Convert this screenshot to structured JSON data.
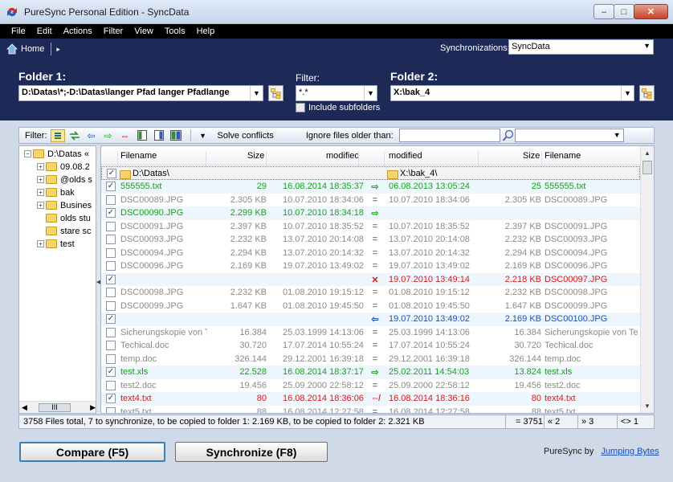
{
  "window": {
    "title": "PureSync Personal Edition  -  SyncData",
    "minimize": "–",
    "maximize": "□",
    "close": "✕"
  },
  "menu": [
    "File",
    "Edit",
    "Actions",
    "Filter",
    "View",
    "Tools",
    "Help"
  ],
  "nav": {
    "home": "Home",
    "sync_label": "Synchronizations:",
    "sync_value": "SyncData"
  },
  "folder1": {
    "label": "Folder 1:",
    "path": "D:\\Datas\\*;-D:\\Datas\\langer Pfad langer Pfadlange"
  },
  "filter": {
    "label": "Filter:",
    "value": "*.*",
    "include_subfolders": "Include subfolders"
  },
  "folder2": {
    "label": "Folder 2:",
    "path": "X:\\bak_4"
  },
  "toolbar": {
    "filter_label": "Filter:",
    "solve": "Solve conflicts",
    "ignore": "Ignore files older than:"
  },
  "tree": {
    "root": "D:\\Datas «",
    "items": [
      "09.08.2",
      "@olds s",
      "bak",
      "Busines",
      "olds stu",
      "stare sc",
      "test"
    ],
    "scroll": "‹  III  ›"
  },
  "grid": {
    "headers": {
      "filename_l": "Filename",
      "size_l": "Size",
      "mod_l": "modified",
      "mod_r": "modified",
      "size_r": "Size",
      "filename_r": "Filename"
    },
    "folder_row": {
      "left": "D:\\Datas\\",
      "right": "X:\\bak_4\\"
    },
    "rows": [
      {
        "name": "555555.txt",
        "size": "29",
        "mod": "16.08.2014 18:35:37",
        "act": "⇨",
        "mod2": "06.08.2013 13:05:24",
        "size2": "25",
        "name2": "555555.txt",
        "checked": true,
        "color": "#17a11a",
        "acolor": "#2aa32a"
      },
      {
        "name": "DSC00089.JPG",
        "size": "2.305 KB",
        "mod": "10.07.2010 18:34:06",
        "act": "=",
        "mod2": "10.07.2010 18:34:06",
        "size2": "2.305 KB",
        "name2": "DSC00089.JPG",
        "checked": false,
        "color": "#8a8a8a",
        "acolor": "#8a8a8a"
      },
      {
        "name": "DSC00090.JPG",
        "size": "2.299 KB",
        "mod": "10.07.2010 18:34:18",
        "act": "⇨",
        "mod2": "",
        "size2": "",
        "name2": "",
        "checked": true,
        "color": "#17a11a",
        "acolor": "#2aa32a"
      },
      {
        "name": "DSC00091.JPG",
        "size": "2.397 KB",
        "mod": "10.07.2010 18:35:52",
        "act": "=",
        "mod2": "10.07.2010 18:35:52",
        "size2": "2.397 KB",
        "name2": "DSC00091.JPG",
        "checked": false,
        "color": "#8a8a8a",
        "acolor": "#8a8a8a"
      },
      {
        "name": "DSC00093.JPG",
        "size": "2.232 KB",
        "mod": "13.07.2010 20:14:08",
        "act": "=",
        "mod2": "13.07.2010 20:14:08",
        "size2": "2.232 KB",
        "name2": "DSC00093.JPG",
        "checked": false,
        "color": "#8a8a8a",
        "acolor": "#8a8a8a"
      },
      {
        "name": "DSC00094.JPG",
        "size": "2.294 KB",
        "mod": "13.07.2010 20:14:32",
        "act": "=",
        "mod2": "13.07.2010 20:14:32",
        "size2": "2.294 KB",
        "name2": "DSC00094.JPG",
        "checked": false,
        "color": "#8a8a8a",
        "acolor": "#8a8a8a"
      },
      {
        "name": "DSC00096.JPG",
        "size": "2.169 KB",
        "mod": "19.07.2010 13:49:02",
        "act": "=",
        "mod2": "19.07.2010 13:49:02",
        "size2": "2.169 KB",
        "name2": "DSC00096.JPG",
        "checked": false,
        "color": "#8a8a8a",
        "acolor": "#8a8a8a"
      },
      {
        "name": "",
        "size": "",
        "mod": "",
        "act": "✕",
        "mod2": "19.07.2010 13:49:14",
        "size2": "2.218 KB",
        "name2": "DSC00097.JPG",
        "checked": true,
        "color": "#d21b1b",
        "acolor": "#d21b1b"
      },
      {
        "name": "DSC00098.JPG",
        "size": "2.232 KB",
        "mod": "01.08.2010 19:15:12",
        "act": "=",
        "mod2": "01.08.2010 19:15:12",
        "size2": "2.232 KB",
        "name2": "DSC00098.JPG",
        "checked": false,
        "color": "#8a8a8a",
        "acolor": "#8a8a8a"
      },
      {
        "name": "DSC00099.JPG",
        "size": "1.647 KB",
        "mod": "01.08.2010 19:45:50",
        "act": "=",
        "mod2": "01.08.2010 19:45:50",
        "size2": "1.647 KB",
        "name2": "DSC00099.JPG",
        "checked": false,
        "color": "#8a8a8a",
        "acolor": "#8a8a8a"
      },
      {
        "name": "",
        "size": "",
        "mod": "",
        "act": "⇦",
        "mod2": "19.07.2010 13:49:02",
        "size2": "2.169 KB",
        "name2": "DSC00100.JPG",
        "checked": true,
        "color": "#1a4fb8",
        "acolor": "#1a4fb8"
      },
      {
        "name": "Sicherungskopie von Te",
        "size": "16.384",
        "mod": "25.03.1999 14:13:06",
        "act": "=",
        "mod2": "25.03.1999 14:13:06",
        "size2": "16.384",
        "name2": "Sicherungskopie von Te",
        "checked": false,
        "color": "#8a8a8a",
        "acolor": "#8a8a8a"
      },
      {
        "name": "Techical.doc",
        "size": "30.720",
        "mod": "17.07.2014 10:55:24",
        "act": "=",
        "mod2": "17.07.2014 10:55:24",
        "size2": "30.720",
        "name2": "Techical.doc",
        "checked": false,
        "color": "#8a8a8a",
        "acolor": "#8a8a8a"
      },
      {
        "name": "temp.doc",
        "size": "326.144",
        "mod": "29.12.2001 16:39:18",
        "act": "=",
        "mod2": "29.12.2001 16:39:18",
        "size2": "326.144",
        "name2": "temp.doc",
        "checked": false,
        "color": "#8a8a8a",
        "acolor": "#8a8a8a"
      },
      {
        "name": "test.xls",
        "size": "22.528",
        "mod": "16.08.2014 18:37:17",
        "act": "⇨",
        "mod2": "25.02.2011 14:54:03",
        "size2": "13.824",
        "name2": "test.xls",
        "checked": true,
        "color": "#17a11a",
        "acolor": "#2aa32a"
      },
      {
        "name": "test2.doc",
        "size": "19.456",
        "mod": "25.09.2000 22:58:12",
        "act": "=",
        "mod2": "25.09.2000 22:58:12",
        "size2": "19.456",
        "name2": "test2.doc",
        "checked": false,
        "color": "#8a8a8a",
        "acolor": "#8a8a8a"
      },
      {
        "name": "text4.txt",
        "size": "80",
        "mod": "16.08.2014 18:36:06",
        "act": "⇎",
        "mod2": "16.08.2014 18:36:16",
        "size2": "80",
        "name2": "text4.txt",
        "checked": true,
        "color": "#d21b1b",
        "acolor": "#d21b1b"
      },
      {
        "name": "text5.txt",
        "size": "88",
        "mod": "16.08.2014 12:27:58",
        "act": "=",
        "mod2": "16.08.2014 12:27:58",
        "size2": "88",
        "name2": "text5.txt",
        "checked": false,
        "color": "#8a8a8a",
        "acolor": "#8a8a8a"
      }
    ]
  },
  "status": {
    "summary": "3758 Files total,  7 to synchronize,  to be copied to folder 1: 2.169 KB,  to be copied to folder 2: 2.321 KB",
    "equal": "= 3751",
    "left": "« 2",
    "right": "» 3",
    "conflict": "<> 1"
  },
  "buttons": {
    "compare": "Compare (F5)",
    "synchronize": "Synchronize (F8)"
  },
  "credit": {
    "text": "PureSync by",
    "link": "Jumping Bytes"
  },
  "colors": {
    "accent_blue": "#1d2a57",
    "sync_green": "#17a11a",
    "delete_red": "#d21b1b",
    "copy_blue": "#1a4fb8"
  }
}
